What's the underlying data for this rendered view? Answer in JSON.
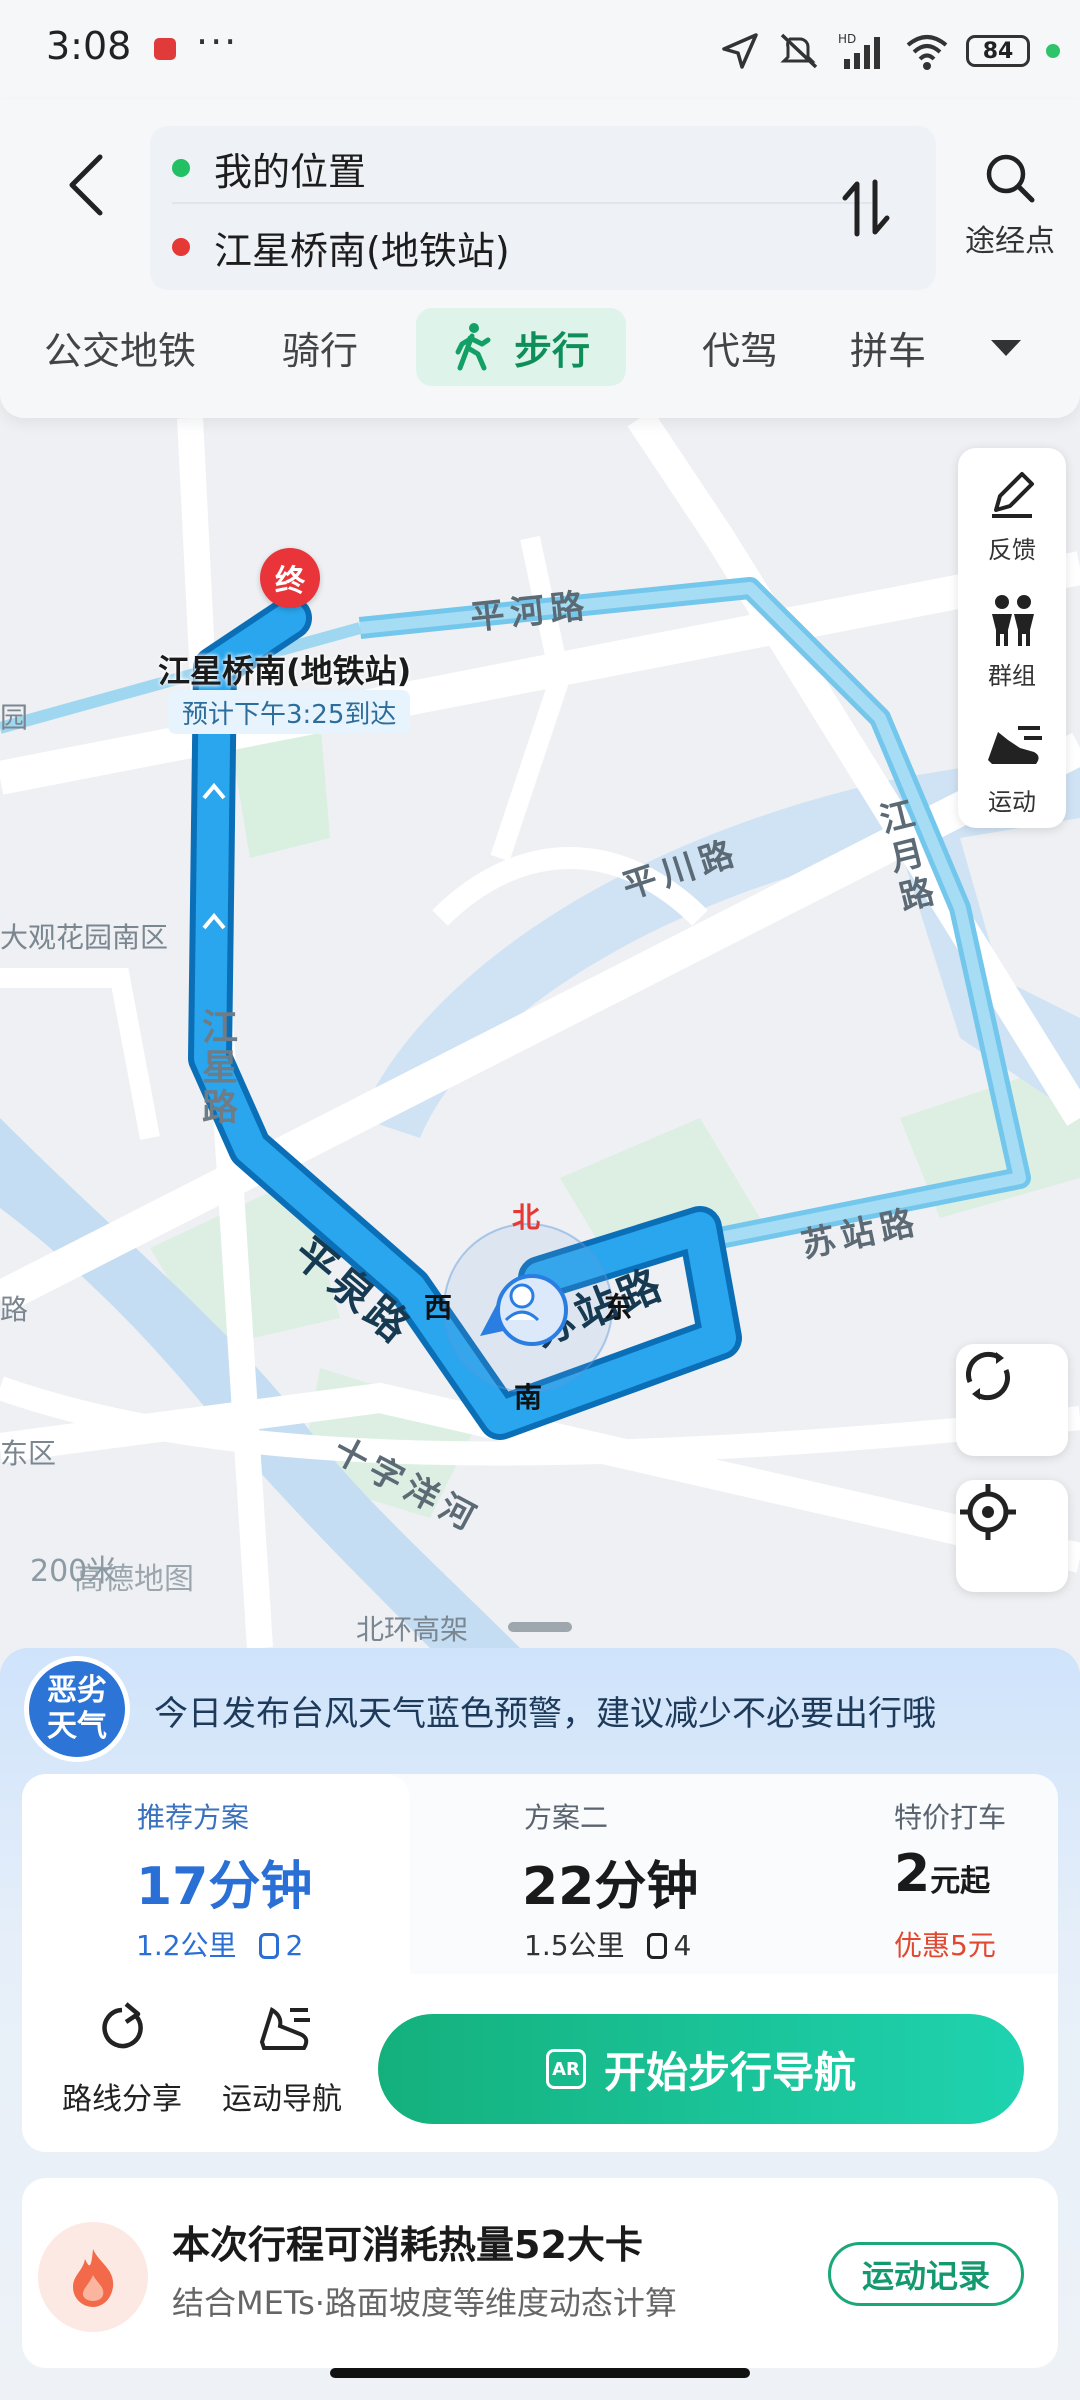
{
  "status_bar": {
    "time": "3:08",
    "battery": "84"
  },
  "search": {
    "origin": "我的位置",
    "destination": "江星桥南(地铁站)",
    "waypoint_label": "途经点"
  },
  "mode_tabs": [
    {
      "label": "公交地铁"
    },
    {
      "label": "骑行"
    },
    {
      "label": "步行"
    },
    {
      "label": "代驾"
    },
    {
      "label": "拼车"
    }
  ],
  "map": {
    "destination_marker": "终",
    "destination_name": "江星桥南(地铁站)",
    "eta": "预计下午3:25到达",
    "labels": {
      "park": "园",
      "scenic_area": "大观花园南区",
      "east_area": "东区",
      "road_left": "路",
      "highway": "北环高架"
    },
    "roads": {
      "pinghe": "平河路",
      "pingchuan": "平川路",
      "jiangyue": "江月路",
      "suzhan_right": "苏站路",
      "jiangxing": "江星路",
      "pingquan": "平泉路",
      "suzhan_route": "苏站路",
      "shizi": "十字洋河"
    },
    "compass": {
      "north": "北",
      "west": "西",
      "east": "东",
      "south": "南"
    },
    "scale": "200米",
    "logo": "高德地图",
    "tools": [
      {
        "label": "反馈",
        "icon": "feedback-pen-icon"
      },
      {
        "label": "群组",
        "icon": "group-icon"
      },
      {
        "label": "运动",
        "icon": "sport-shoe-icon"
      }
    ]
  },
  "weather": {
    "badge": "恶劣天气",
    "badge_line1": "恶劣",
    "badge_line2": "天气",
    "message": "今日发布台风天气蓝色预警，建议减少不必要出行哦"
  },
  "plans": [
    {
      "title": "推荐方案",
      "time": "17分钟",
      "distance": "1.2公里",
      "lights": "2"
    },
    {
      "title": "方案二",
      "time": "22分钟",
      "distance": "1.5公里",
      "lights": "4"
    },
    {
      "title": "特价打车",
      "price_num": "2",
      "price_unit": "元起",
      "discount": "优惠5元"
    }
  ],
  "actions": {
    "share": "路线分享",
    "sport_nav": "运动导航",
    "start": "开始步行导航",
    "ar": "AR"
  },
  "calorie": {
    "title": "本次行程可消耗热量52大卡",
    "subtitle": "结合METs·路面坡度等维度动态计算",
    "record_button": "运动记录"
  },
  "colors": {
    "accent_green": "#14b07c",
    "route_blue": "#1e9be0",
    "plan_blue": "#2a6fd6",
    "discount_red": "#e2472f"
  }
}
